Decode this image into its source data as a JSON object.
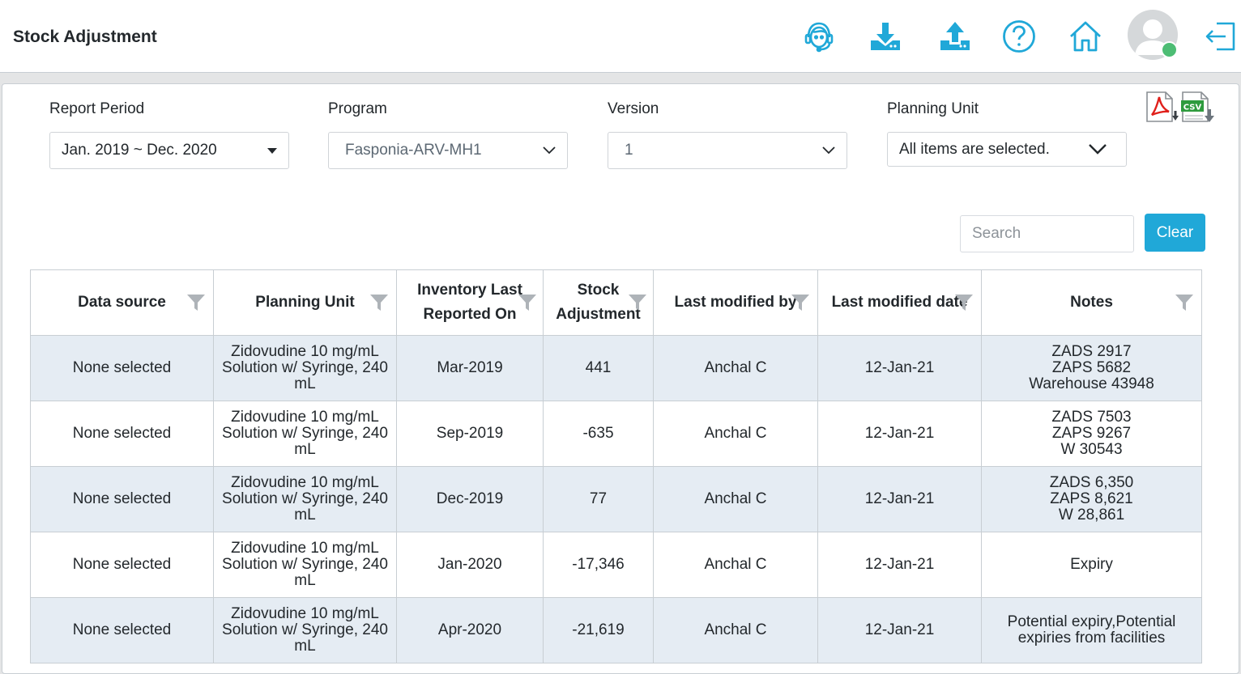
{
  "header": {
    "title": "Stock Adjustment",
    "icons": [
      "support-icon",
      "download-icon",
      "upload-icon",
      "help-icon",
      "home-icon",
      "avatar",
      "logout-icon"
    ],
    "accent_color": "#20a8d8"
  },
  "filters": {
    "report_period": {
      "label": "Report Period",
      "value": "Jan. 2019 ~ Dec. 2020"
    },
    "program": {
      "label": "Program",
      "value": "Fasponia-ARV-MH1"
    },
    "version": {
      "label": "Version",
      "value": "1"
    },
    "planning_unit": {
      "label": "Planning Unit",
      "value": "All items are selected."
    }
  },
  "export": {
    "icons": [
      "pdf-icon",
      "csv-icon"
    ]
  },
  "search": {
    "placeholder": "Search",
    "clear_label": "Clear"
  },
  "table": {
    "columns": [
      "Data source",
      "Planning Unit",
      "Inventory Last Reported On",
      "Stock Adjustment",
      "Last modified by",
      "Last modified date",
      "Notes"
    ],
    "rows": [
      [
        "None selected",
        "Zidovudine 10 mg/mL Solution w/ Syringe, 240 mL",
        "Mar-2019",
        "441",
        "Anchal C",
        "12-Jan-21",
        "ZADS 2917\nZAPS 5682\nWarehouse 43948"
      ],
      [
        "None selected",
        "Zidovudine 10 mg/mL Solution w/ Syringe, 240 mL",
        "Sep-2019",
        "-635",
        "Anchal C",
        "12-Jan-21",
        "ZADS 7503\nZAPS 9267\nW 30543"
      ],
      [
        "None selected",
        "Zidovudine 10 mg/mL Solution w/ Syringe, 240 mL",
        "Dec-2019",
        "77",
        "Anchal C",
        "12-Jan-21",
        "ZADS 6,350\nZAPS 8,621\nW 28,861"
      ],
      [
        "None selected",
        "Zidovudine 10 mg/mL Solution w/ Syringe, 240 mL",
        "Jan-2020",
        "-17,346",
        "Anchal C",
        "12-Jan-21",
        "Expiry"
      ],
      [
        "None selected",
        "Zidovudine 10 mg/mL Solution w/ Syringe, 240 mL",
        "Apr-2020",
        "-21,619",
        "Anchal C",
        "12-Jan-21",
        "Potential expiry,Potential expiries from facilities"
      ]
    ]
  }
}
